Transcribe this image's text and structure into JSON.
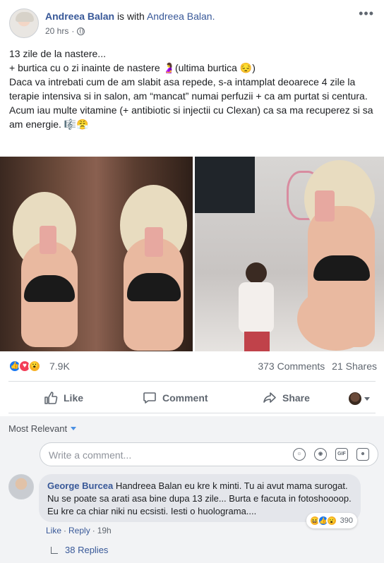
{
  "post": {
    "author": "Andreea Balan",
    "with_text": "is with",
    "with_name": "Andreea Balan.",
    "time": "20 hrs",
    "privacy_separator": "·",
    "privacy_icon": "globe-icon",
    "more_icon": "more-options-icon",
    "text_lines": [
      "13 zile de la nastere...",
      "+ burtica cu o zi inainte de nastere 🤰(ultima burtica 😔)",
      "Daca va intrebati cum de am slabit asa repede, s-a intamplat deoarece 4 zile la terapie intensiva si in salon, am “mancat” numai perfuzii + ca am purtat si centura.",
      "Acum iau multe vitamine (+ antibiotic si injectii cu Clexan) ca sa ma recuperez si sa am energie. 🎼😤"
    ]
  },
  "stats": {
    "reactions_count": "7.9K",
    "comments": "373 Comments",
    "shares": "21 Shares",
    "reaction_icons": [
      "like-reaction-icon",
      "love-reaction-icon",
      "wow-reaction-icon"
    ]
  },
  "actions": {
    "like": "Like",
    "comment": "Comment",
    "share": "Share"
  },
  "comments_section": {
    "sort_label": "Most Relevant",
    "write_placeholder": "Write a comment...",
    "gif_label": "GIF",
    "comment": {
      "author": "George Burcea",
      "text": "Handreea Balan eu kre k minti. Tu ai avut mama surogat. Nu se poate sa arati asa bine dupa 13 zile... Burta e facuta in fotoshoooop. Eu kre ca chiar niki nu ecsisti. Iesti o huolograma....",
      "reaction_count": "390",
      "like_link": "Like",
      "reply_link": "Reply",
      "time": "19h",
      "separator": "·"
    },
    "replies_label": "38 Replies"
  },
  "colors": {
    "link": "#385898",
    "secondary_text": "#606770",
    "like_blue": "#1877f2",
    "love_red": "#f33e58",
    "wow_yellow": "#f7b125"
  }
}
